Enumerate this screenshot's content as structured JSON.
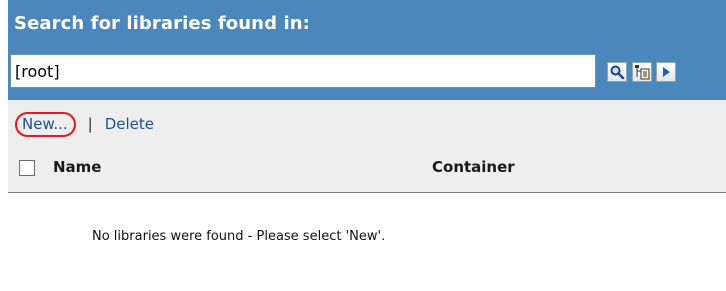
{
  "search": {
    "header": "Search for libraries found in:",
    "value": "[root]"
  },
  "toolbar": {
    "new_label": "New...",
    "separator": "|",
    "delete_label": "Delete"
  },
  "table": {
    "columns": [
      "Name",
      "Container"
    ]
  },
  "empty_message": "No libraries were found - Please select 'New'.",
  "icons": {
    "search": "search-icon",
    "browse": "browse-tree-icon",
    "go": "go-arrow-icon"
  },
  "colors": {
    "header_bg": "#4b87bb",
    "toolbar_bg": "#eeeeee",
    "link": "#1f4f99",
    "highlight": "#e01b24"
  }
}
